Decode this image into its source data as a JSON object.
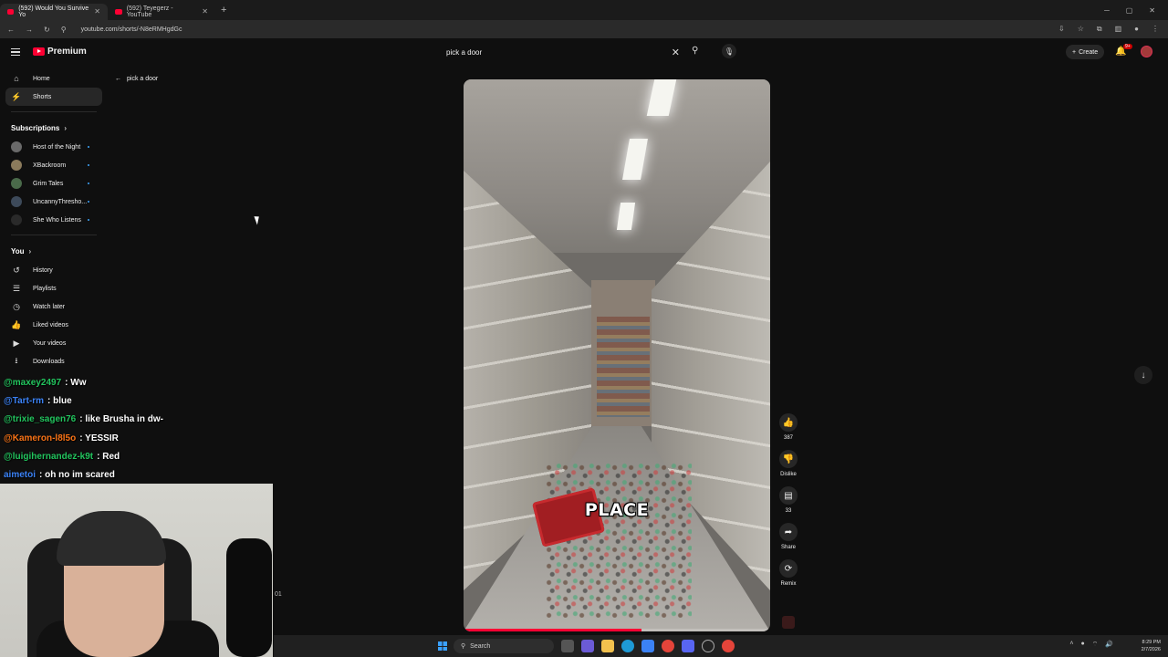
{
  "browser": {
    "tabs": [
      {
        "label": "(592) Would You Survive Yo"
      },
      {
        "label": "(592) Teyegerz - YouTube"
      }
    ],
    "url": "youtube.com/shorts/-N8eRMHgdGc"
  },
  "header": {
    "brand": "Premium",
    "search_value": "pick a door",
    "create_label": "Create",
    "notifications_badge": "9+"
  },
  "back": {
    "label": "pick a door"
  },
  "sidebar": {
    "main": [
      {
        "label": "Home"
      },
      {
        "label": "Shorts"
      }
    ],
    "subscriptions_heading": "Subscriptions",
    "subscriptions": [
      {
        "label": "Host of the Night"
      },
      {
        "label": "XBackroom"
      },
      {
        "label": "Grim Tales"
      },
      {
        "label": "UncannyThresho..."
      },
      {
        "label": "She Who Listens"
      }
    ],
    "you_heading": "You",
    "you": [
      {
        "label": "History"
      },
      {
        "label": "Playlists"
      },
      {
        "label": "Watch later"
      },
      {
        "label": "Liked videos"
      },
      {
        "label": "Your videos"
      },
      {
        "label": "Downloads"
      }
    ]
  },
  "video": {
    "caption": "PLACE",
    "progress": 0.58
  },
  "actions": {
    "like_count": "387",
    "dislike_label": "Dislike",
    "comment_count": "33",
    "share_label": "Share",
    "remix_label": "Remix"
  },
  "chat": [
    {
      "user": "@maxey2497",
      "msg": ": Ww",
      "color": "#22c55e"
    },
    {
      "user": "@Tart-rm",
      "msg": ": blue",
      "color": "#3b82f6"
    },
    {
      "user": "@trixie_sagen76",
      "msg": ": like Brusha in dw-",
      "color": "#22c55e"
    },
    {
      "user": "@Kameron-l8l5o",
      "msg": ": YESSIR",
      "color": "#f97316"
    },
    {
      "user": "@luigihernandez-k9t",
      "msg": ": Red",
      "color": "#22c55e"
    },
    {
      "user": "aimetoi",
      "msg": ": oh no im scared",
      "color": "#3b82f6"
    }
  ],
  "cam_label": "01",
  "taskbar": {
    "search_placeholder": "Search",
    "time": "8:29 PM",
    "date": "2/7/2026"
  }
}
